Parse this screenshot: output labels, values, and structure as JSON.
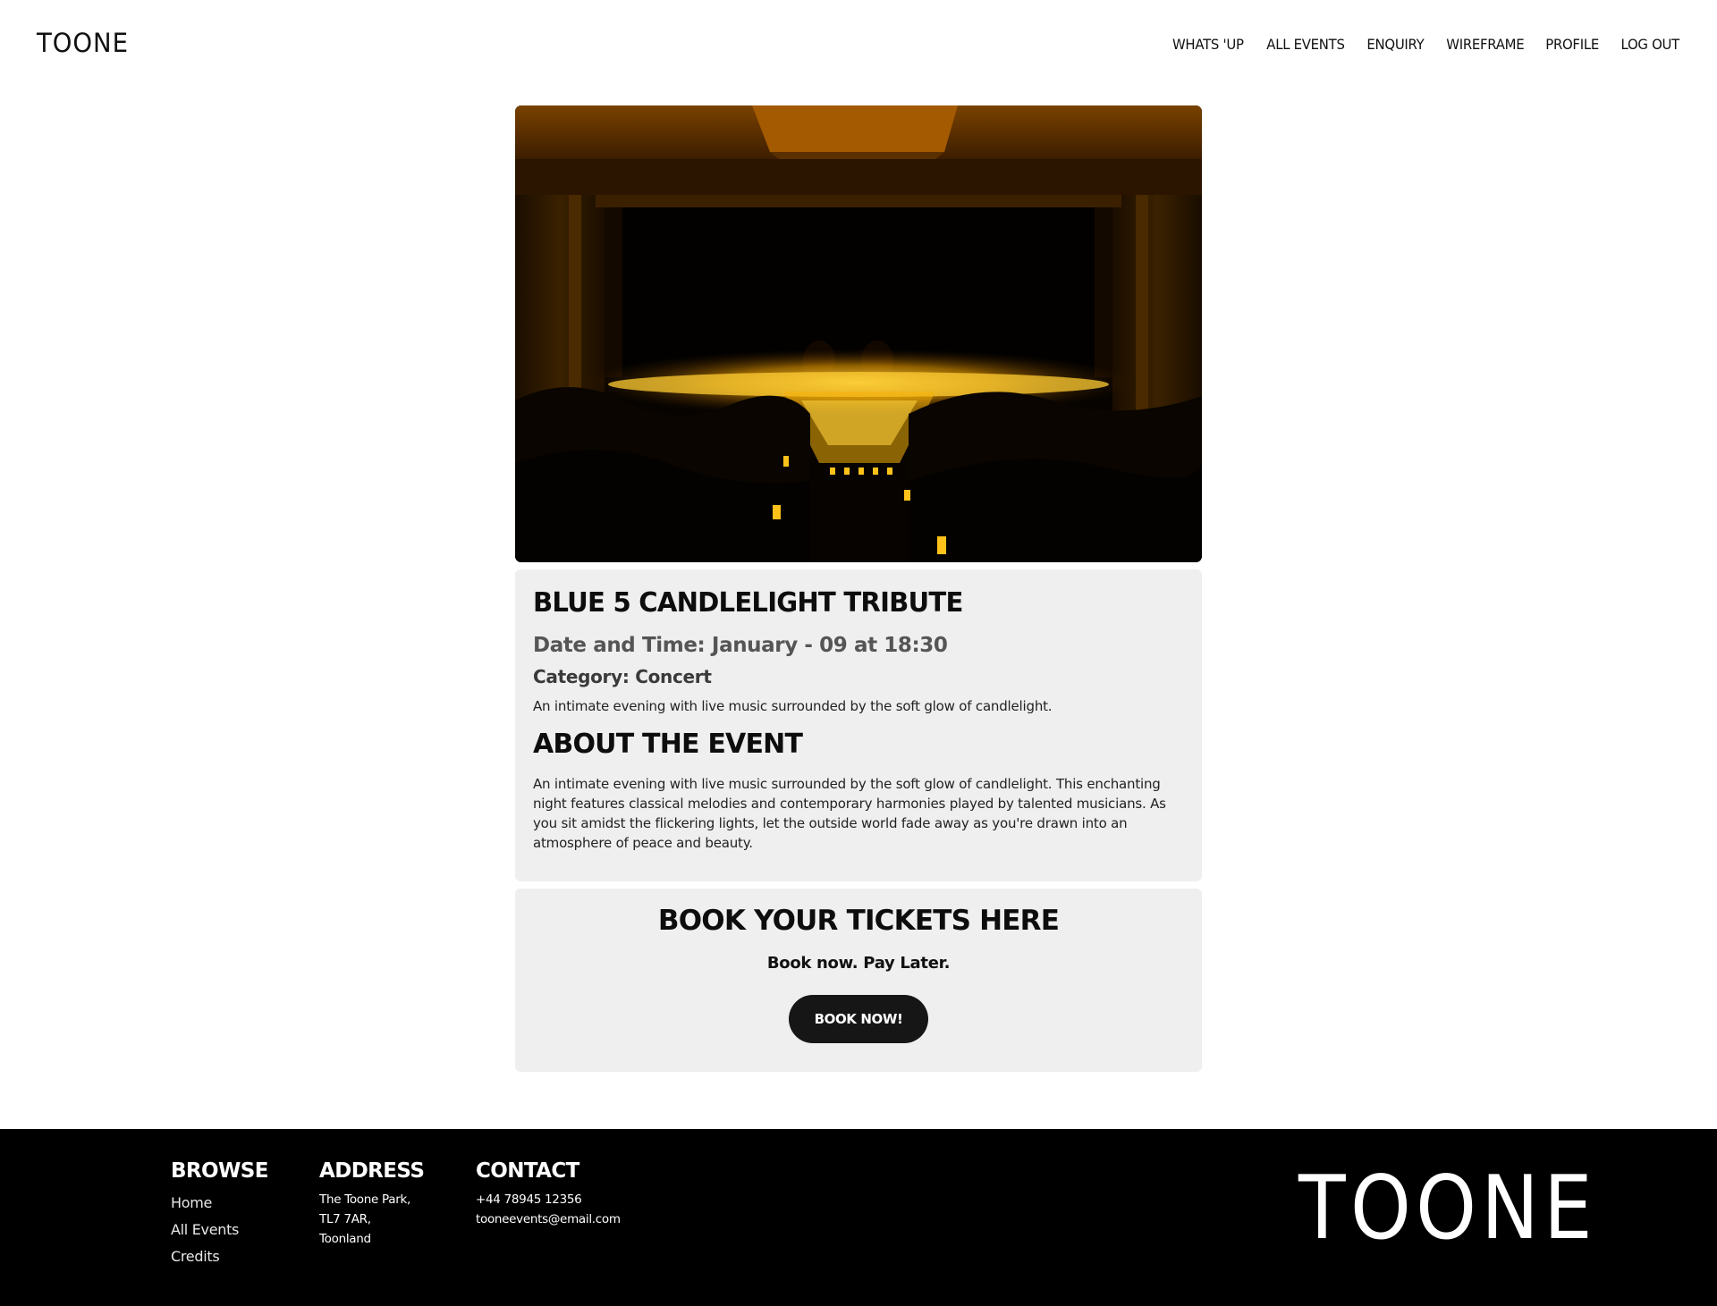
{
  "header": {
    "logo": "TOONE",
    "nav": [
      {
        "label": "WHATS 'UP"
      },
      {
        "label": "ALL EVENTS"
      },
      {
        "label": "ENQUIRY"
      },
      {
        "label": "WIREFRAME"
      },
      {
        "label": "PROFILE"
      },
      {
        "label": "LOG OUT"
      }
    ]
  },
  "hero": {
    "icon": "candlelight-concert-photo",
    "accent": "#f5a400"
  },
  "event": {
    "title": "BLUE 5 CANDLELIGHT TRIBUTE",
    "datetime": "Date and Time: January - 09 at 18:30",
    "category": "Category: Concert",
    "summary": "An intimate evening with live music surrounded by the soft glow of candlelight.",
    "about_title": "ABOUT THE EVENT",
    "about_body": "An intimate evening with live music surrounded by the soft glow of candlelight. This enchanting night features classical melodies and contemporary harmonies played by talented musicians. As you sit amidst the flickering lights, let the outside world fade away as you're drawn into an atmosphere of peace and beauty."
  },
  "booking": {
    "title": "BOOK YOUR TICKETS HERE",
    "subtitle": "Book now. Pay Later.",
    "button_label": "BOOK NOW!"
  },
  "footer": {
    "browse": {
      "title": "BROWSE",
      "links": [
        "Home",
        "All Events",
        "Credits"
      ]
    },
    "address": {
      "title": "ADDRESS",
      "lines": [
        "The Toone Park,",
        "TL7 7AR,",
        "Toonland"
      ]
    },
    "contact": {
      "title": "CONTACT",
      "phone": "+44 78945 12356",
      "email": "tooneevents@email.com"
    },
    "logo": "TOONE"
  },
  "colors": {
    "panel_bg": "#efefef",
    "footer_bg": "#000000",
    "button_bg": "#161616"
  }
}
